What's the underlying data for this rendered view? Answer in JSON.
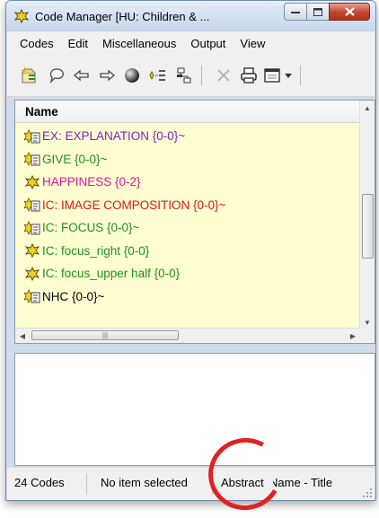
{
  "window": {
    "title": "Code Manager [HU: Children & ..."
  },
  "menu": [
    "Codes",
    "Edit",
    "Miscellaneous",
    "Output",
    "View"
  ],
  "toolbar": {
    "icons": [
      "new-code-icon",
      "comment-icon",
      "back-icon",
      "forward-icon",
      "color-icon",
      "split-code-icon",
      "network-icon",
      "delete-icon",
      "print-icon",
      "view-options-icon",
      "dropdown-arrow-icon"
    ]
  },
  "list": {
    "column_header": "Name",
    "rows": [
      {
        "label": "EX:  EXPLANATION {0-0}~",
        "color": "#7b1fd0"
      },
      {
        "label": "GIVE {0-0}~",
        "color": "#1d8f1d"
      },
      {
        "label": "HAPPINESS {0-2}",
        "color": "#e0159a"
      },
      {
        "label": "IC:  IMAGE COMPOSITION {0-0}~",
        "color": "#e01515"
      },
      {
        "label": "IC: FOCUS {0-0}~",
        "color": "#1d8f1d"
      },
      {
        "label": "IC: focus_right {0-0}",
        "color": "#1d8f1d"
      },
      {
        "label": "IC: focus_upper half {0-0}",
        "color": "#1d8f1d"
      },
      {
        "label": "NHC {0-0}~",
        "color": "#000000"
      }
    ]
  },
  "status": {
    "count": "24 Codes",
    "selection": "No item selected",
    "abstract": "Abstract",
    "sort": "Name - Title"
  },
  "colors": {
    "highlight": "#e22222",
    "list_background": "#ffffd2"
  }
}
